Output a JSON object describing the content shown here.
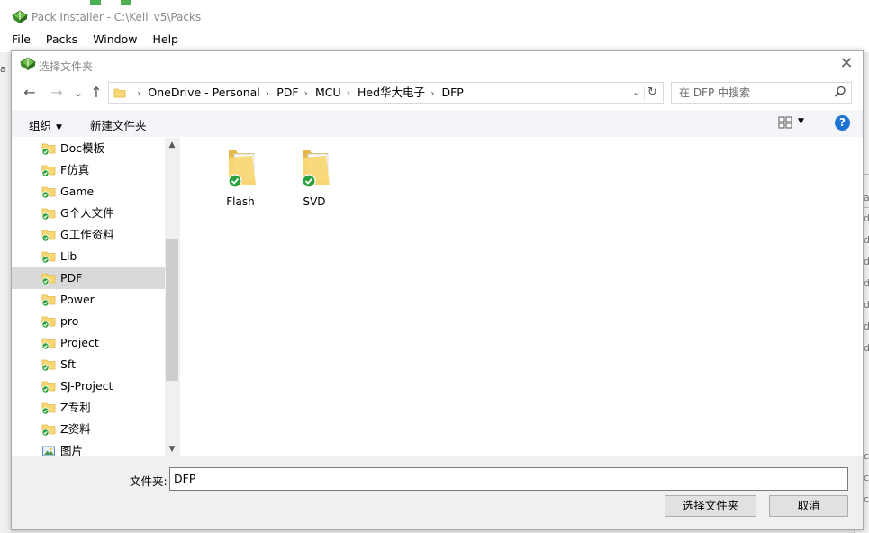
{
  "app": {
    "title": "Pack Installer - C:\\Keil_v5\\Packs",
    "menu": [
      "File",
      "Packs",
      "Window",
      "Help"
    ],
    "left_char": "a",
    "right_chars": [
      "a",
      "d",
      "d",
      "d",
      "d",
      "d",
      "d",
      "d",
      "c",
      "c",
      "c"
    ]
  },
  "dialog": {
    "title": "选择文件夹",
    "close_glyph": "✕",
    "nav": {
      "back": "←",
      "forward": "→",
      "recent": "⌄",
      "up": "↑"
    },
    "breadcrumb": [
      "OneDrive - Personal",
      "PDF",
      "MCU",
      "Hed华大电子",
      "DFP"
    ],
    "breadcrumb_sep": "›",
    "address_dropdown": "⌄",
    "refresh_glyph": "↻",
    "search_placeholder": "在 DFP 中搜索",
    "toolbar": {
      "organize": "组织",
      "organize_caret": "▼",
      "new_folder": "新建文件夹",
      "view_caret": "▼",
      "help": "?"
    },
    "tree": {
      "items": [
        {
          "label": "Doc模板",
          "icon": "folder-synced-icon"
        },
        {
          "label": "F仿真",
          "icon": "folder-synced-icon"
        },
        {
          "label": "Game",
          "icon": "folder-synced-icon"
        },
        {
          "label": "G个人文件",
          "icon": "folder-synced-icon"
        },
        {
          "label": "G工作资料",
          "icon": "folder-synced-icon"
        },
        {
          "label": "Lib",
          "icon": "folder-synced-icon"
        },
        {
          "label": "PDF",
          "icon": "folder-synced-icon",
          "selected": true
        },
        {
          "label": "Power",
          "icon": "folder-synced-icon"
        },
        {
          "label": "pro",
          "icon": "folder-synced-icon"
        },
        {
          "label": "Project",
          "icon": "folder-synced-icon"
        },
        {
          "label": "Sft",
          "icon": "folder-synced-icon"
        },
        {
          "label": "SJ-Project",
          "icon": "folder-synced-icon"
        },
        {
          "label": "Z专利",
          "icon": "folder-synced-icon"
        },
        {
          "label": "Z资料",
          "icon": "folder-synced-icon"
        },
        {
          "label": "图片",
          "icon": "pictures-folder-icon"
        }
      ],
      "scroll_up": "▲",
      "scroll_down": "▼"
    },
    "files": [
      {
        "name": "Flash",
        "icon": "folder-synced-icon"
      },
      {
        "name": "SVD",
        "icon": "folder-synced-icon"
      }
    ],
    "folder_label": "文件夹:",
    "folder_value": "DFP",
    "select_button": "选择文件夹",
    "cancel_button": "取消"
  },
  "colors": {
    "folder": "#f8d775",
    "folder_dark": "#e6b84a",
    "sync_check": "#2aa13b",
    "help_blue": "#1e74d6",
    "selected_bg": "#d9d9d9"
  }
}
